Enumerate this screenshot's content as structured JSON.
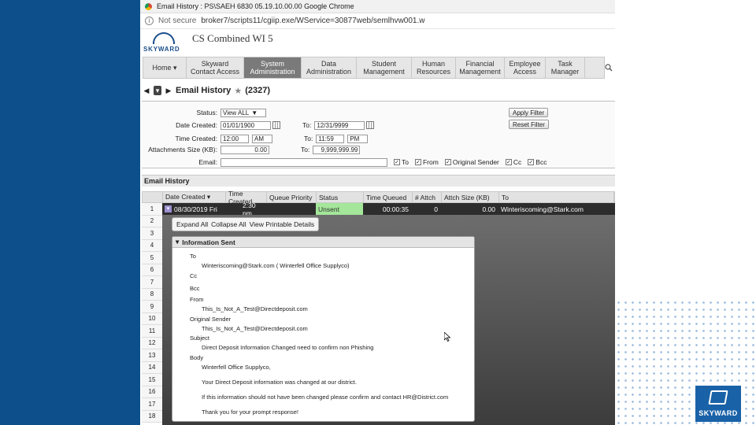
{
  "browser": {
    "tab_title": "Email History : PS\\SAEH 6830 05.19.10.00.00 Google Chrome",
    "security": "Not secure",
    "url": "broker7/scripts11/cgiip.exe/WService=30877web/semlhvw001.w"
  },
  "app": {
    "logo_text": "SKYWARD",
    "title": "CS Combined WI 5"
  },
  "nav": {
    "items": [
      {
        "label": "Home ▾",
        "active": false
      },
      {
        "label": "Skyward Contact Access",
        "active": false
      },
      {
        "label": "System Administration",
        "active": true
      },
      {
        "label": "Data Administration",
        "active": false
      },
      {
        "label": "Student Management",
        "active": false
      },
      {
        "label": "Human Resources",
        "active": false
      },
      {
        "label": "Financial Management",
        "active": false
      },
      {
        "label": "Employee Access",
        "active": false
      },
      {
        "label": "Task Manager",
        "active": false
      }
    ]
  },
  "page": {
    "title": "Email History",
    "count": "(2327)"
  },
  "filters": {
    "status_label": "Status:",
    "status_value": "View ALL",
    "date_created_label": "Date Created:",
    "date_from": "01/01/1900",
    "to_label": "To:",
    "date_to": "12/31/9999",
    "time_created_label": "Time Created:",
    "time_from": "12:00",
    "time_from_ampm": "AM",
    "time_to": "11:59",
    "time_to_ampm": "PM",
    "attach_label": "Attachments Size (KB):",
    "attach_from": "0.00",
    "attach_to": "9,999,999.99",
    "email_label": "Email:",
    "email_value": "",
    "checkboxes": [
      "To",
      "From",
      "Original Sender",
      "Cc",
      "Bcc"
    ],
    "apply_button": "Apply Filter",
    "reset_button": "Reset Filter"
  },
  "section_title": "Email History",
  "grid": {
    "columns": [
      "Date Created ▾",
      "Time Created",
      "Queue Priority",
      "Status",
      "Time Queued",
      "# Attch",
      "Attch Size (KB)",
      "To"
    ],
    "row": {
      "num": "1",
      "date": "08/30/2019 Fri",
      "time": "2:30 pm",
      "status": "Unsent",
      "queued": "00:00:35",
      "attch": "0",
      "size": "0.00",
      "to": "Winteriscoming@Stark.com"
    },
    "row_numbers": [
      "1",
      "2",
      "3",
      "4",
      "5",
      "6",
      "7",
      "8",
      "9",
      "10",
      "11",
      "12",
      "13",
      "14",
      "15",
      "16",
      "17",
      "18"
    ]
  },
  "detail_toolbar": {
    "expand": "Expand All",
    "collapse": "Collapse All",
    "printable": "View Printable Details"
  },
  "info": {
    "header": "Information Sent",
    "to_label": "To",
    "to_value": "Winteriscoming@Stark.com ( Winterfell Office Supplyco)",
    "cc_label": "Cc",
    "bcc_label": "Bcc",
    "from_label": "From",
    "from_value": "This_Is_Not_A_Test@Directdeposit.com",
    "orig_label": "Original Sender",
    "orig_value": "This_Is_Not_A_Test@Directdeposit.com",
    "subject_label": "Subject",
    "subject_value": "Direct Deposit Information Changed need to confirm non Phishing",
    "body_label": "Body",
    "body_lines": [
      "Winterfell Office Supplyco,",
      "Your Direct Deposit information was changed at our district.",
      "If this information should not have been changed please confirm and contact HR@District.com",
      "Thank you for your prompt response!"
    ]
  },
  "slide": {
    "brand": "SKYWARD"
  }
}
